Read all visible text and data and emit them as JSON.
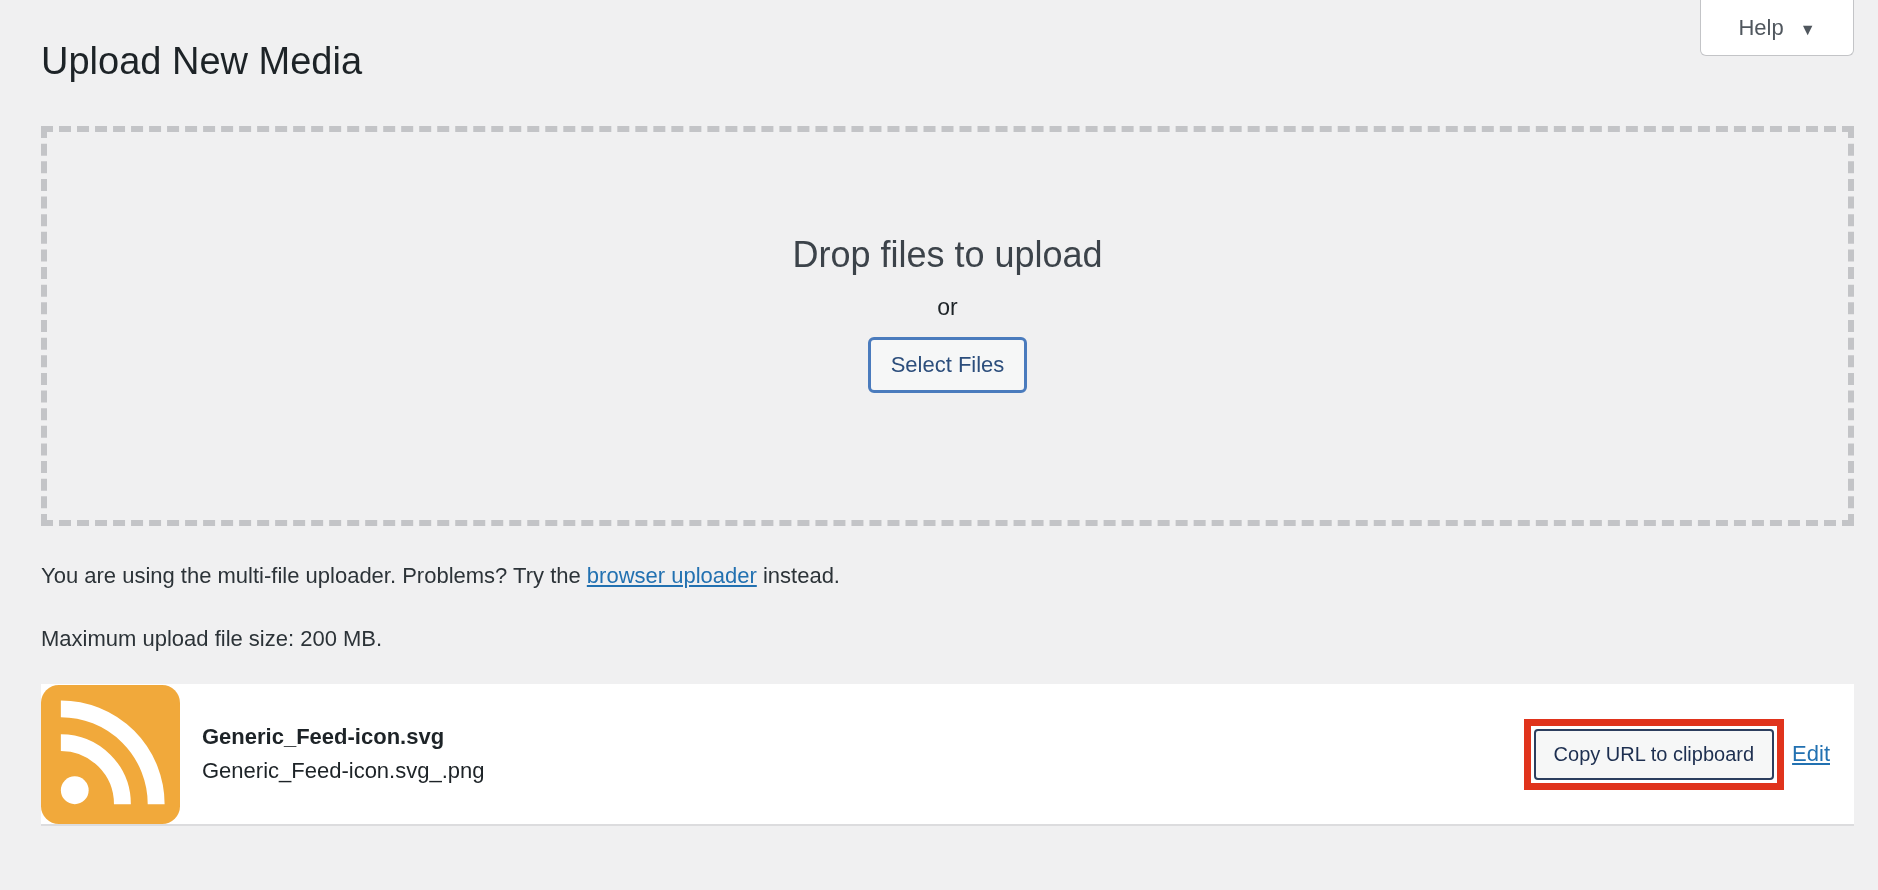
{
  "help_button": {
    "label": "Help",
    "caret": "▼"
  },
  "title": "Upload New Media",
  "dropzone": {
    "heading": "Drop files to upload",
    "or": "or",
    "button": "Select Files"
  },
  "notice": {
    "before": "You are using the multi-file uploader. Problems? Try the ",
    "link": "browser uploader",
    "after": " instead."
  },
  "max_size": "Maximum upload file size: 200 MB.",
  "uploads": [
    {
      "title": "Generic_Feed-icon.svg",
      "filename": "Generic_Feed-icon.svg_.png",
      "copy_button": "Copy URL to clipboard",
      "highlighted": true,
      "edit": "Edit"
    }
  ]
}
